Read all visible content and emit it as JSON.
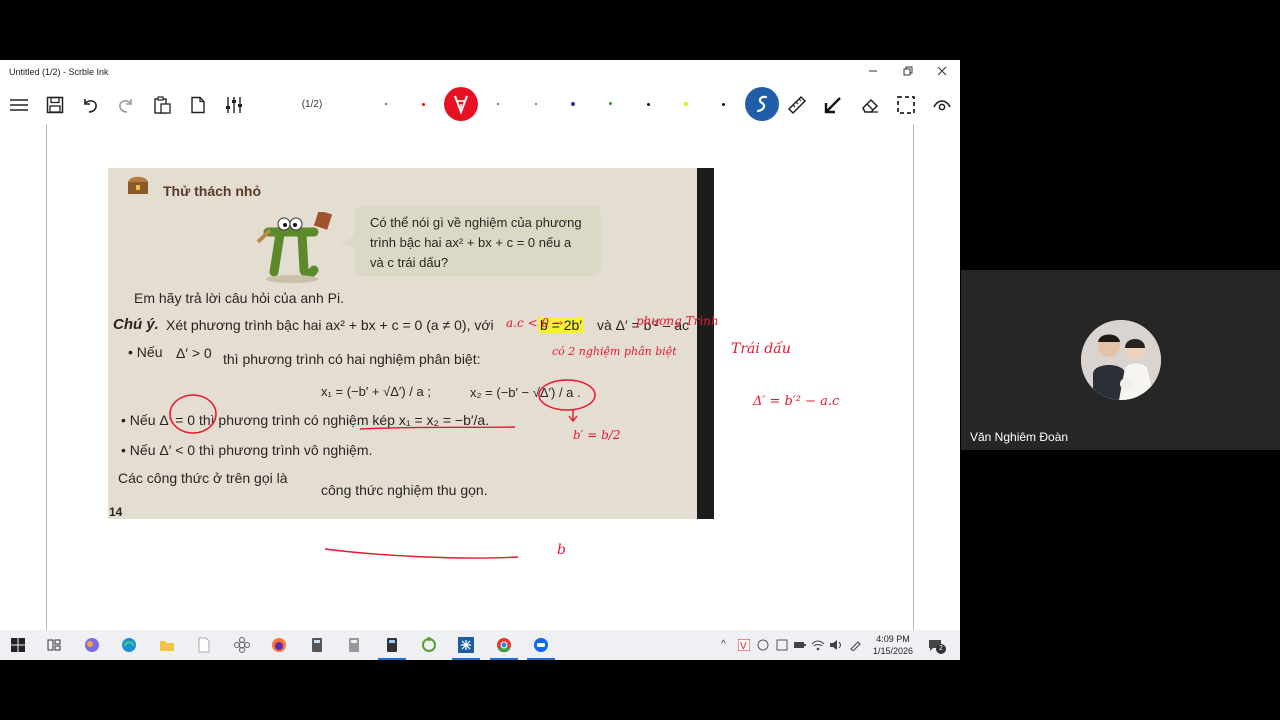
{
  "window": {
    "title": "Untitled (1/2) - Scrble Ink"
  },
  "toolbar": {
    "page_indicator": "(1/2)"
  },
  "colors": {
    "accent_red": "#e81123",
    "accent_blue": "#1e5fa8",
    "ink_red": "#e8172e",
    "highlight": "#f4ef3a"
  },
  "book": {
    "section_title": "Thử thách nhỏ",
    "bubble_line1": "Có thể nói gì về nghiệm của phương",
    "bubble_line2": "trình bậc hai ax² + bx + c = 0 nếu a",
    "bubble_line3": "và c trái dấu?",
    "prompt": "Em hãy trả lời câu hỏi của anh Pi.",
    "note_label": "Chú ý.",
    "note_text": "Xét phương trình bậc hai ax² + bx + c = 0 (a ≠ 0), với",
    "note_highlight": "b = 2b′",
    "note_tail": "và Δ′ = b′² – ac",
    "case1_prefix": "• Nếu",
    "case1_cond": "Δ′ > 0",
    "case1_text": "thì phương trình có hai nghiệm phân biệt:",
    "formula_x1": "x₁ = (−b′ + √Δ′) / a ;",
    "formula_x2": "x₂ = (−b′ − √Δ′) / a .",
    "case2": "• Nếu Δ′ = 0 thì phương trình có nghiệm kép x₁ = x₂ = −b′/a.",
    "case3": "• Nếu Δ′ < 0 thì phương trình vô nghiệm.",
    "summary_prefix": "Các công thức ở trên gọi là",
    "summary_term": "công thức nghiệm thu gọn.",
    "page_number": "14"
  },
  "annotations": {
    "ac_neg": "a.c < 0 →",
    "phuong_trinh": "phương Trình",
    "co_hai_nghiem": "có 2 nghiệm phân biệt",
    "trai_dau": "Trái dấu",
    "delta_formula": "Δ′ = b′² − a.c",
    "b_prime": "b′ = b/2",
    "b_letter": "b"
  },
  "taskbar": {
    "time": "4:09 PM",
    "date": "1/15/2026",
    "notification_count": "2"
  },
  "participant": {
    "name": "Văn Nghiêm Đoàn"
  }
}
